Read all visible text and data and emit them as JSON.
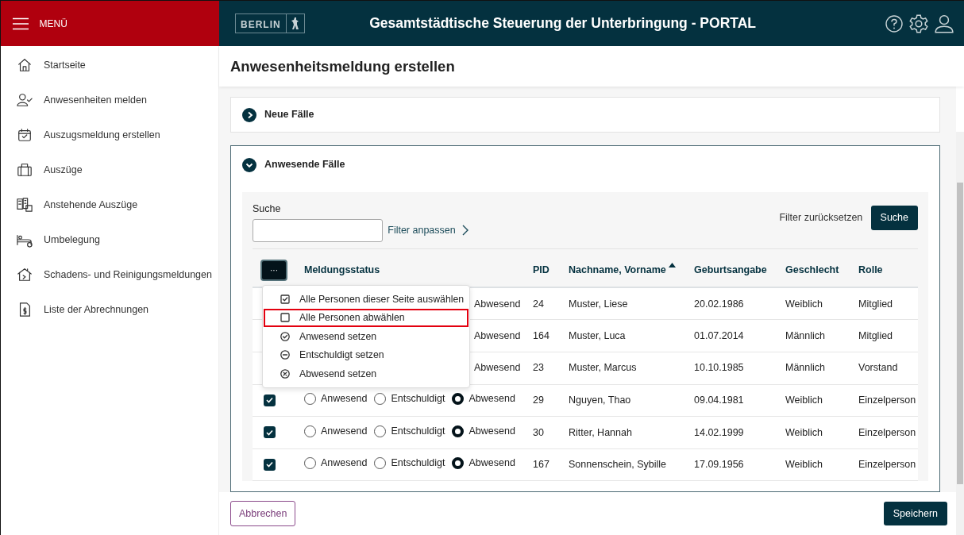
{
  "menu": {
    "label": "MENÜ"
  },
  "header": {
    "logo": "BERLIN",
    "title": "Gesamtstädtische Steuerung der Unterbringung - PORTAL"
  },
  "sidebar": {
    "items": [
      {
        "label": "Startseite",
        "kind": "home"
      },
      {
        "label": "Anwesenheiten melden",
        "kind": "person"
      },
      {
        "label": "Auszugsmeldung erstellen",
        "kind": "calendar"
      },
      {
        "label": "Auszüge",
        "kind": "bag"
      },
      {
        "label": "Anstehende Auszüge",
        "kind": "buildings"
      },
      {
        "label": "Umbelegung",
        "kind": "bed"
      },
      {
        "label": "Schadens- und Reinigungsmeldungen",
        "kind": "house"
      },
      {
        "label": "Liste der Abrechnungen",
        "kind": "invoice"
      }
    ]
  },
  "page_title": "Anwesenheitsmeldung erstellen",
  "sections": [
    {
      "title": "Neue Fälle",
      "expanded": false
    },
    {
      "title": "Anwesende Fälle",
      "expanded": true
    }
  ],
  "search": {
    "label": "Suche",
    "filter_link": "Filter anpassen",
    "reset": "Filter zurücksetzen",
    "button": "Suche"
  },
  "table": {
    "menu_button": "···",
    "columns": [
      {
        "label": "Meldungsstatus",
        "sorted": false
      },
      {
        "label": "PID",
        "sorted": false
      },
      {
        "label": "Nachname, Vorname",
        "sorted": true
      },
      {
        "label": "Geburtsangabe",
        "sorted": false
      },
      {
        "label": "Geschlecht",
        "sorted": false
      },
      {
        "label": "Rolle",
        "sorted": false
      }
    ],
    "rows": [
      {
        "kind": "covered",
        "status_label": "Abwesend",
        "pid": "24",
        "name": "Muster, Liese",
        "birth": "20.02.1986",
        "gender": "Weiblich",
        "role": "Mitglied"
      },
      {
        "kind": "covered",
        "status_label": "Abwesend",
        "pid": "164",
        "name": "Muster, Luca",
        "birth": "01.07.2014",
        "gender": "Männlich",
        "role": "Mitglied"
      },
      {
        "kind": "covered",
        "status_label": "Abwesend",
        "pid": "23",
        "name": "Muster, Marcus",
        "birth": "10.10.1985",
        "gender": "Männlich",
        "role": "Vorstand"
      },
      {
        "kind": "full",
        "checked": true,
        "options": [
          {
            "label": "Anwesend",
            "selected": false
          },
          {
            "label": "Entschuldigt",
            "selected": false
          },
          {
            "label": "Abwesend",
            "selected": true
          }
        ],
        "pid": "29",
        "name": "Nguyen, Thao",
        "birth": "09.04.1981",
        "gender": "Weiblich",
        "role": "Einzelperson"
      },
      {
        "kind": "full",
        "checked": true,
        "options": [
          {
            "label": "Anwesend",
            "selected": false
          },
          {
            "label": "Entschuldigt",
            "selected": false
          },
          {
            "label": "Abwesend",
            "selected": true
          }
        ],
        "pid": "30",
        "name": "Ritter, Hannah",
        "birth": "14.02.1999",
        "gender": "Weiblich",
        "role": "Einzelperson"
      },
      {
        "kind": "full",
        "checked": true,
        "options": [
          {
            "label": "Anwesend",
            "selected": false
          },
          {
            "label": "Entschuldigt",
            "selected": false
          },
          {
            "label": "Abwesend",
            "selected": true
          }
        ],
        "pid": "167",
        "name": "Sonnenschein, Sybille",
        "birth": "17.09.1956",
        "gender": "Weiblich",
        "role": "Einzelperson"
      }
    ]
  },
  "row_menu": [
    {
      "label": "Alle Personen dieser Seite auswählen",
      "kind": "check-square",
      "highlighted": false
    },
    {
      "label": "Alle Personen abwählen",
      "kind": "square",
      "highlighted": true
    },
    {
      "label": "Anwesend setzen",
      "kind": "circle-check",
      "highlighted": false
    },
    {
      "label": "Entschuldigt setzen",
      "kind": "circle-minus",
      "highlighted": false
    },
    {
      "label": "Abwesend setzen",
      "kind": "circle-x",
      "highlighted": false
    }
  ],
  "footer": {
    "cancel": "Abbrechen",
    "save": "Speichern"
  }
}
